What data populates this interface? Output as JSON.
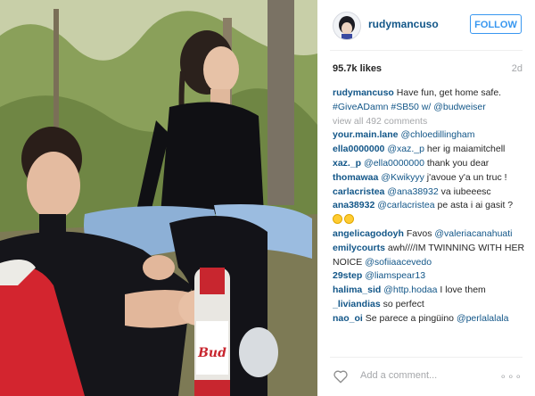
{
  "post": {
    "username": "rudymancuso",
    "follow_label": "FOLLOW",
    "likes": "95.7k likes",
    "age": "2d",
    "caption_user": "rudymancuso",
    "caption_text": "Have fun, get home safe.",
    "caption_tags": "#GiveADamn #SB50 w/ @budweiser",
    "view_all": "view all 492 comments",
    "add_comment_placeholder": "Add a comment...",
    "more_label": "∘∘∘",
    "photo_can_text": "Bud",
    "comments": [
      {
        "user": "your.main.lane",
        "mention": "@chloedillingham",
        "text": ""
      },
      {
        "user": "ella0000000",
        "mention": "@xaz._p",
        "text": "her ig maiamitchell"
      },
      {
        "user": "xaz._p",
        "mention": "@ella0000000",
        "text": "thank you dear"
      },
      {
        "user": "thomawaa",
        "mention": "@Kwikyyy",
        "text": "j'avoue y'a un truc !"
      },
      {
        "user": "carlacristea",
        "mention": "@ana38932",
        "text": "va iubeeesc"
      },
      {
        "user": "ana38932",
        "mention": "@carlacristea",
        "text": "pe asta i ai gasit ?"
      },
      {
        "user": "angelicagodoyh",
        "mention": "",
        "text": "Favos",
        "mention2": "@valeriacanahuati"
      },
      {
        "user": "emilycourts",
        "mention": "",
        "text": "awh////IM TWINNING WITH HER"
      },
      {
        "user": "",
        "mention": "",
        "text": "NOICE",
        "mention2": "@sofiiaacevedo"
      },
      {
        "user": "29step",
        "mention": "@liamspear13",
        "text": ""
      },
      {
        "user": "halima_sid",
        "mention": "@http.hodaa",
        "text": "I love them"
      },
      {
        "user": "_liviandias",
        "mention": "",
        "text": "so perfect"
      },
      {
        "user": "nao_oi",
        "mention": "",
        "text": "Se parece a pingüino",
        "mention2": "@perlalalala"
      }
    ]
  },
  "colors": {
    "link": "#125688",
    "follow": "#3897f0",
    "muted": "#a5a7aa",
    "text": "#262626"
  },
  "icons": {
    "heart": "heart-icon",
    "more": "more-options-icon"
  }
}
